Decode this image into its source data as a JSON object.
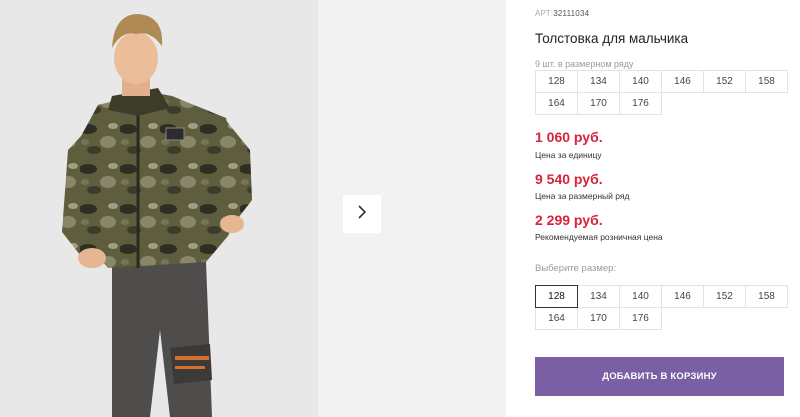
{
  "product": {
    "art_prefix": "АРТ:",
    "art_value": "32111034",
    "title": "Толстовка для мальчика",
    "pack_note": "9 шт. в размерном ряду",
    "pack_sizes": [
      "128",
      "134",
      "140",
      "146",
      "152",
      "158",
      "164",
      "170",
      "176"
    ]
  },
  "prices": {
    "unit_price": "1 060 руб.",
    "unit_label": "Цена за единицу",
    "row_price": "9 540 руб.",
    "row_label": "Цена за размерный ряд",
    "retail_price": "2 299 руб.",
    "retail_label": "Рекомендуемая розничная цена",
    "accent_color": "#d6243a"
  },
  "size_select": {
    "label": "Выберите размер:",
    "options": [
      "128",
      "134",
      "140",
      "146",
      "152",
      "158",
      "164",
      "170",
      "176"
    ],
    "selected": "128"
  },
  "cart": {
    "add_label": "ДОБАВИТЬ В КОРЗИНУ",
    "button_color": "#7b5fa5"
  },
  "gallery": {
    "next_icon": "chevron-right-icon"
  }
}
